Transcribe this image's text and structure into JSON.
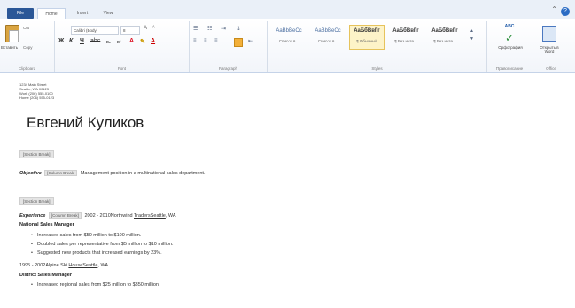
{
  "tabs": [
    "File",
    "Home",
    "Insert",
    "View"
  ],
  "ribbon": {
    "clipboard": {
      "paste": "Вставить",
      "cut": "Cut",
      "copy": "Copy",
      "label": "Clipboard"
    },
    "font": {
      "name": "Calibri (Body)",
      "size": "8",
      "label": "Font"
    },
    "paragraph": {
      "label": "Paragraph"
    },
    "styles": {
      "label": "Styles",
      "items": [
        {
          "sample": "AaBbBeCc",
          "name": "Список в..."
        },
        {
          "sample": "AaBbBeCc",
          "name": "Список в..."
        },
        {
          "sample": "AaБбВвГг",
          "name": "¶ Обычный"
        },
        {
          "sample": "AaБбВвГг",
          "name": "¶ Без инте..."
        },
        {
          "sample": "AaБбВвГг",
          "name": "¶ Без инте..."
        }
      ]
    },
    "editing": {
      "spell_label": "Орфография",
      "doc_label": "Открыть в Word",
      "group_label": "Правописание",
      "other_label": "Office"
    }
  },
  "document": {
    "address": [
      "1234 Main Street",
      "Seattle, WA 00123",
      "Work (206) 555-0100",
      "Home (206) 555-0123"
    ],
    "name": "Евгений Куликов",
    "section_break": "[Section Break]",
    "column_break": "[Column Break]",
    "objective_label": "Objective",
    "objective_text": "Management position in a multinational sales department.",
    "experience_label": "Experience",
    "job1_dates": "2002 - 2010",
    "job1_company": "Northwind",
    "job1_company_link": "TradersSeattle",
    "job1_location": ", WA",
    "job1_title": "National Sales Manager",
    "job1_bullets": [
      "Increased sales from $50 million to $100 million.",
      "Doubled sales per representative from $5 million to $10 million.",
      "Suggested new products that increased earnings by 23%."
    ],
    "job2_dates": "1995 - 2002",
    "job2_company": "Alpine Ski ",
    "job2_company_link": "HouseSeattle",
    "job2_location": ", WA",
    "job2_title": "District Sales Manager",
    "job2_bullets": [
      "Increased regional sales from $25 million to $350 million."
    ]
  }
}
